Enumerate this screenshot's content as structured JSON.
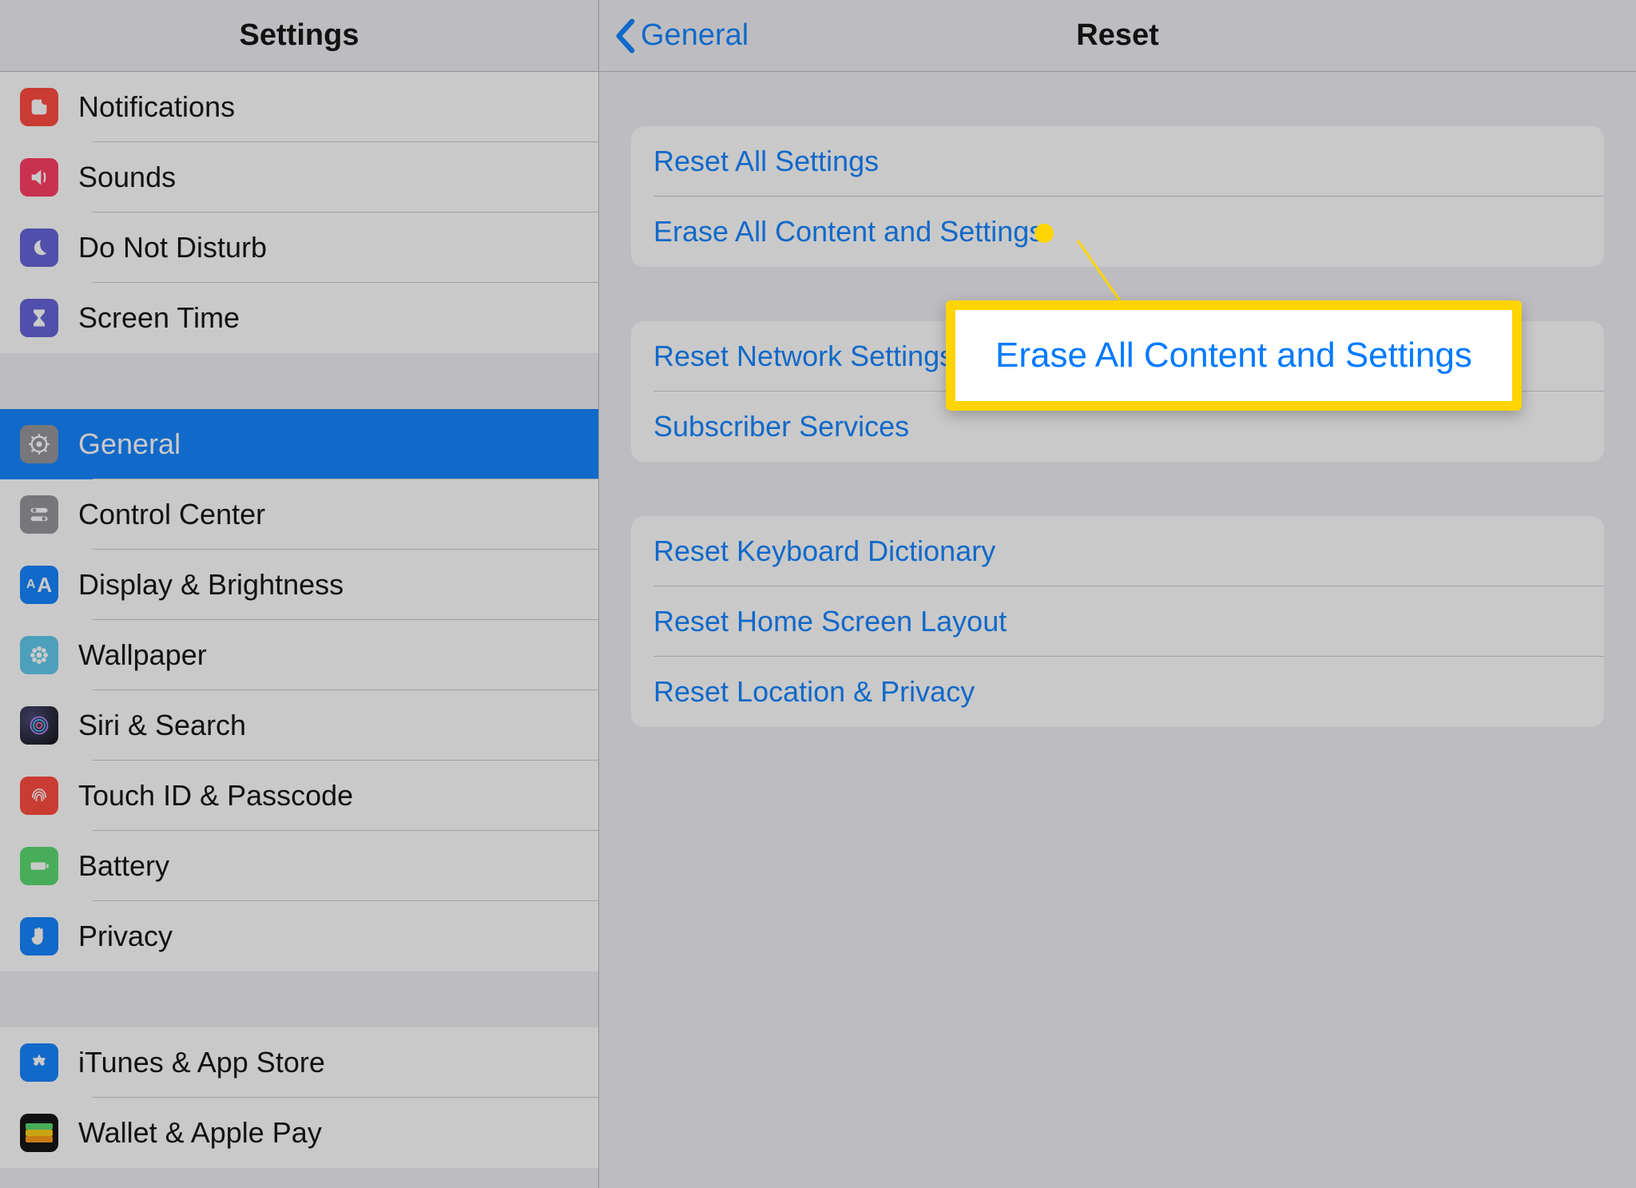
{
  "sidebar": {
    "title": "Settings",
    "group1": [
      {
        "label": "Notifications"
      },
      {
        "label": "Sounds"
      },
      {
        "label": "Do Not Disturb"
      },
      {
        "label": "Screen Time"
      }
    ],
    "group2": [
      {
        "label": "General"
      },
      {
        "label": "Control Center"
      },
      {
        "label": "Display & Brightness"
      },
      {
        "label": "Wallpaper"
      },
      {
        "label": "Siri & Search"
      },
      {
        "label": "Touch ID & Passcode"
      },
      {
        "label": "Battery"
      },
      {
        "label": "Privacy"
      }
    ],
    "group3": [
      {
        "label": "iTunes & App Store"
      },
      {
        "label": "Wallet & Apple Pay"
      }
    ]
  },
  "detail": {
    "back_label": "General",
    "title": "Reset",
    "group1": [
      {
        "label": "Reset All Settings"
      },
      {
        "label": "Erase All Content and Settings"
      }
    ],
    "group2": [
      {
        "label": "Reset Network Settings"
      },
      {
        "label": "Subscriber Services"
      }
    ],
    "group3": [
      {
        "label": "Reset Keyboard Dictionary"
      },
      {
        "label": "Reset Home Screen Layout"
      },
      {
        "label": "Reset Location & Privacy"
      }
    ]
  },
  "callout": {
    "text": "Erase All Content and Settings"
  }
}
